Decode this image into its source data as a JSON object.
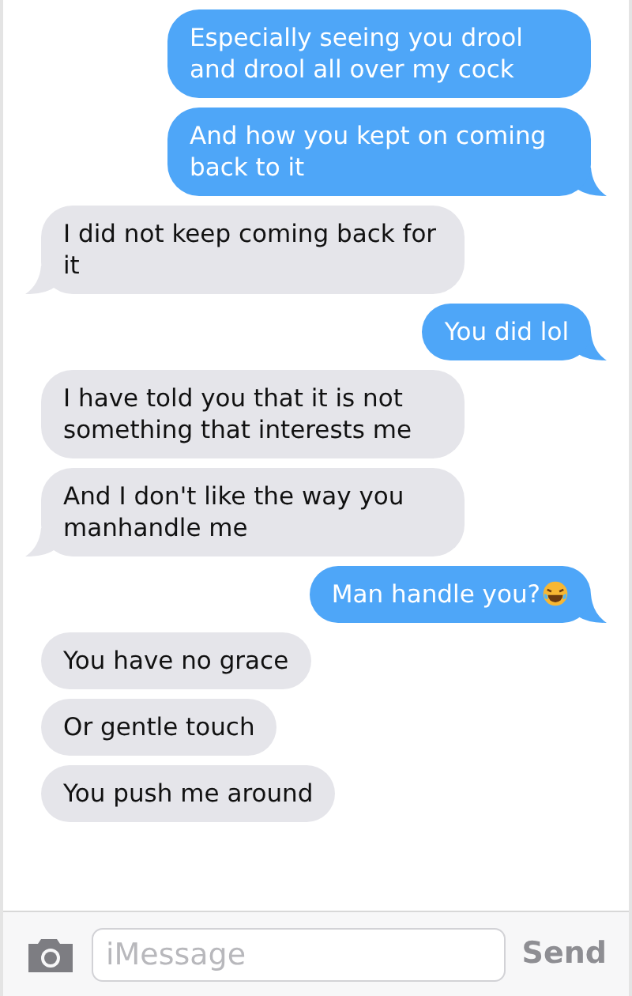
{
  "messages": [
    {
      "kind": "sent",
      "text": "Especially seeing you drool and drool all over my cock",
      "tail": false,
      "emoji": false
    },
    {
      "kind": "sent",
      "text": "And how you kept on coming back to it",
      "tail": true,
      "emoji": false
    },
    {
      "kind": "received",
      "text": "I did not keep coming back for it",
      "tail": true,
      "emoji": false
    },
    {
      "kind": "sent",
      "text": "You did lol",
      "tail": true,
      "emoji": false
    },
    {
      "kind": "received",
      "text": "I have told you that it is not something that interests me",
      "tail": false,
      "emoji": false
    },
    {
      "kind": "received",
      "text": "And I don't like the way you manhandle me",
      "tail": true,
      "emoji": false
    },
    {
      "kind": "sent",
      "text": "Man handle you?",
      "tail": true,
      "emoji": true
    },
    {
      "kind": "received",
      "text": "You have no grace",
      "tail": false,
      "emoji": false
    },
    {
      "kind": "received",
      "text": "Or gentle touch",
      "tail": false,
      "emoji": false
    },
    {
      "kind": "received",
      "text": "You push me around",
      "tail": false,
      "emoji": false
    }
  ],
  "composer": {
    "placeholder": "iMessage",
    "send": "Send"
  }
}
